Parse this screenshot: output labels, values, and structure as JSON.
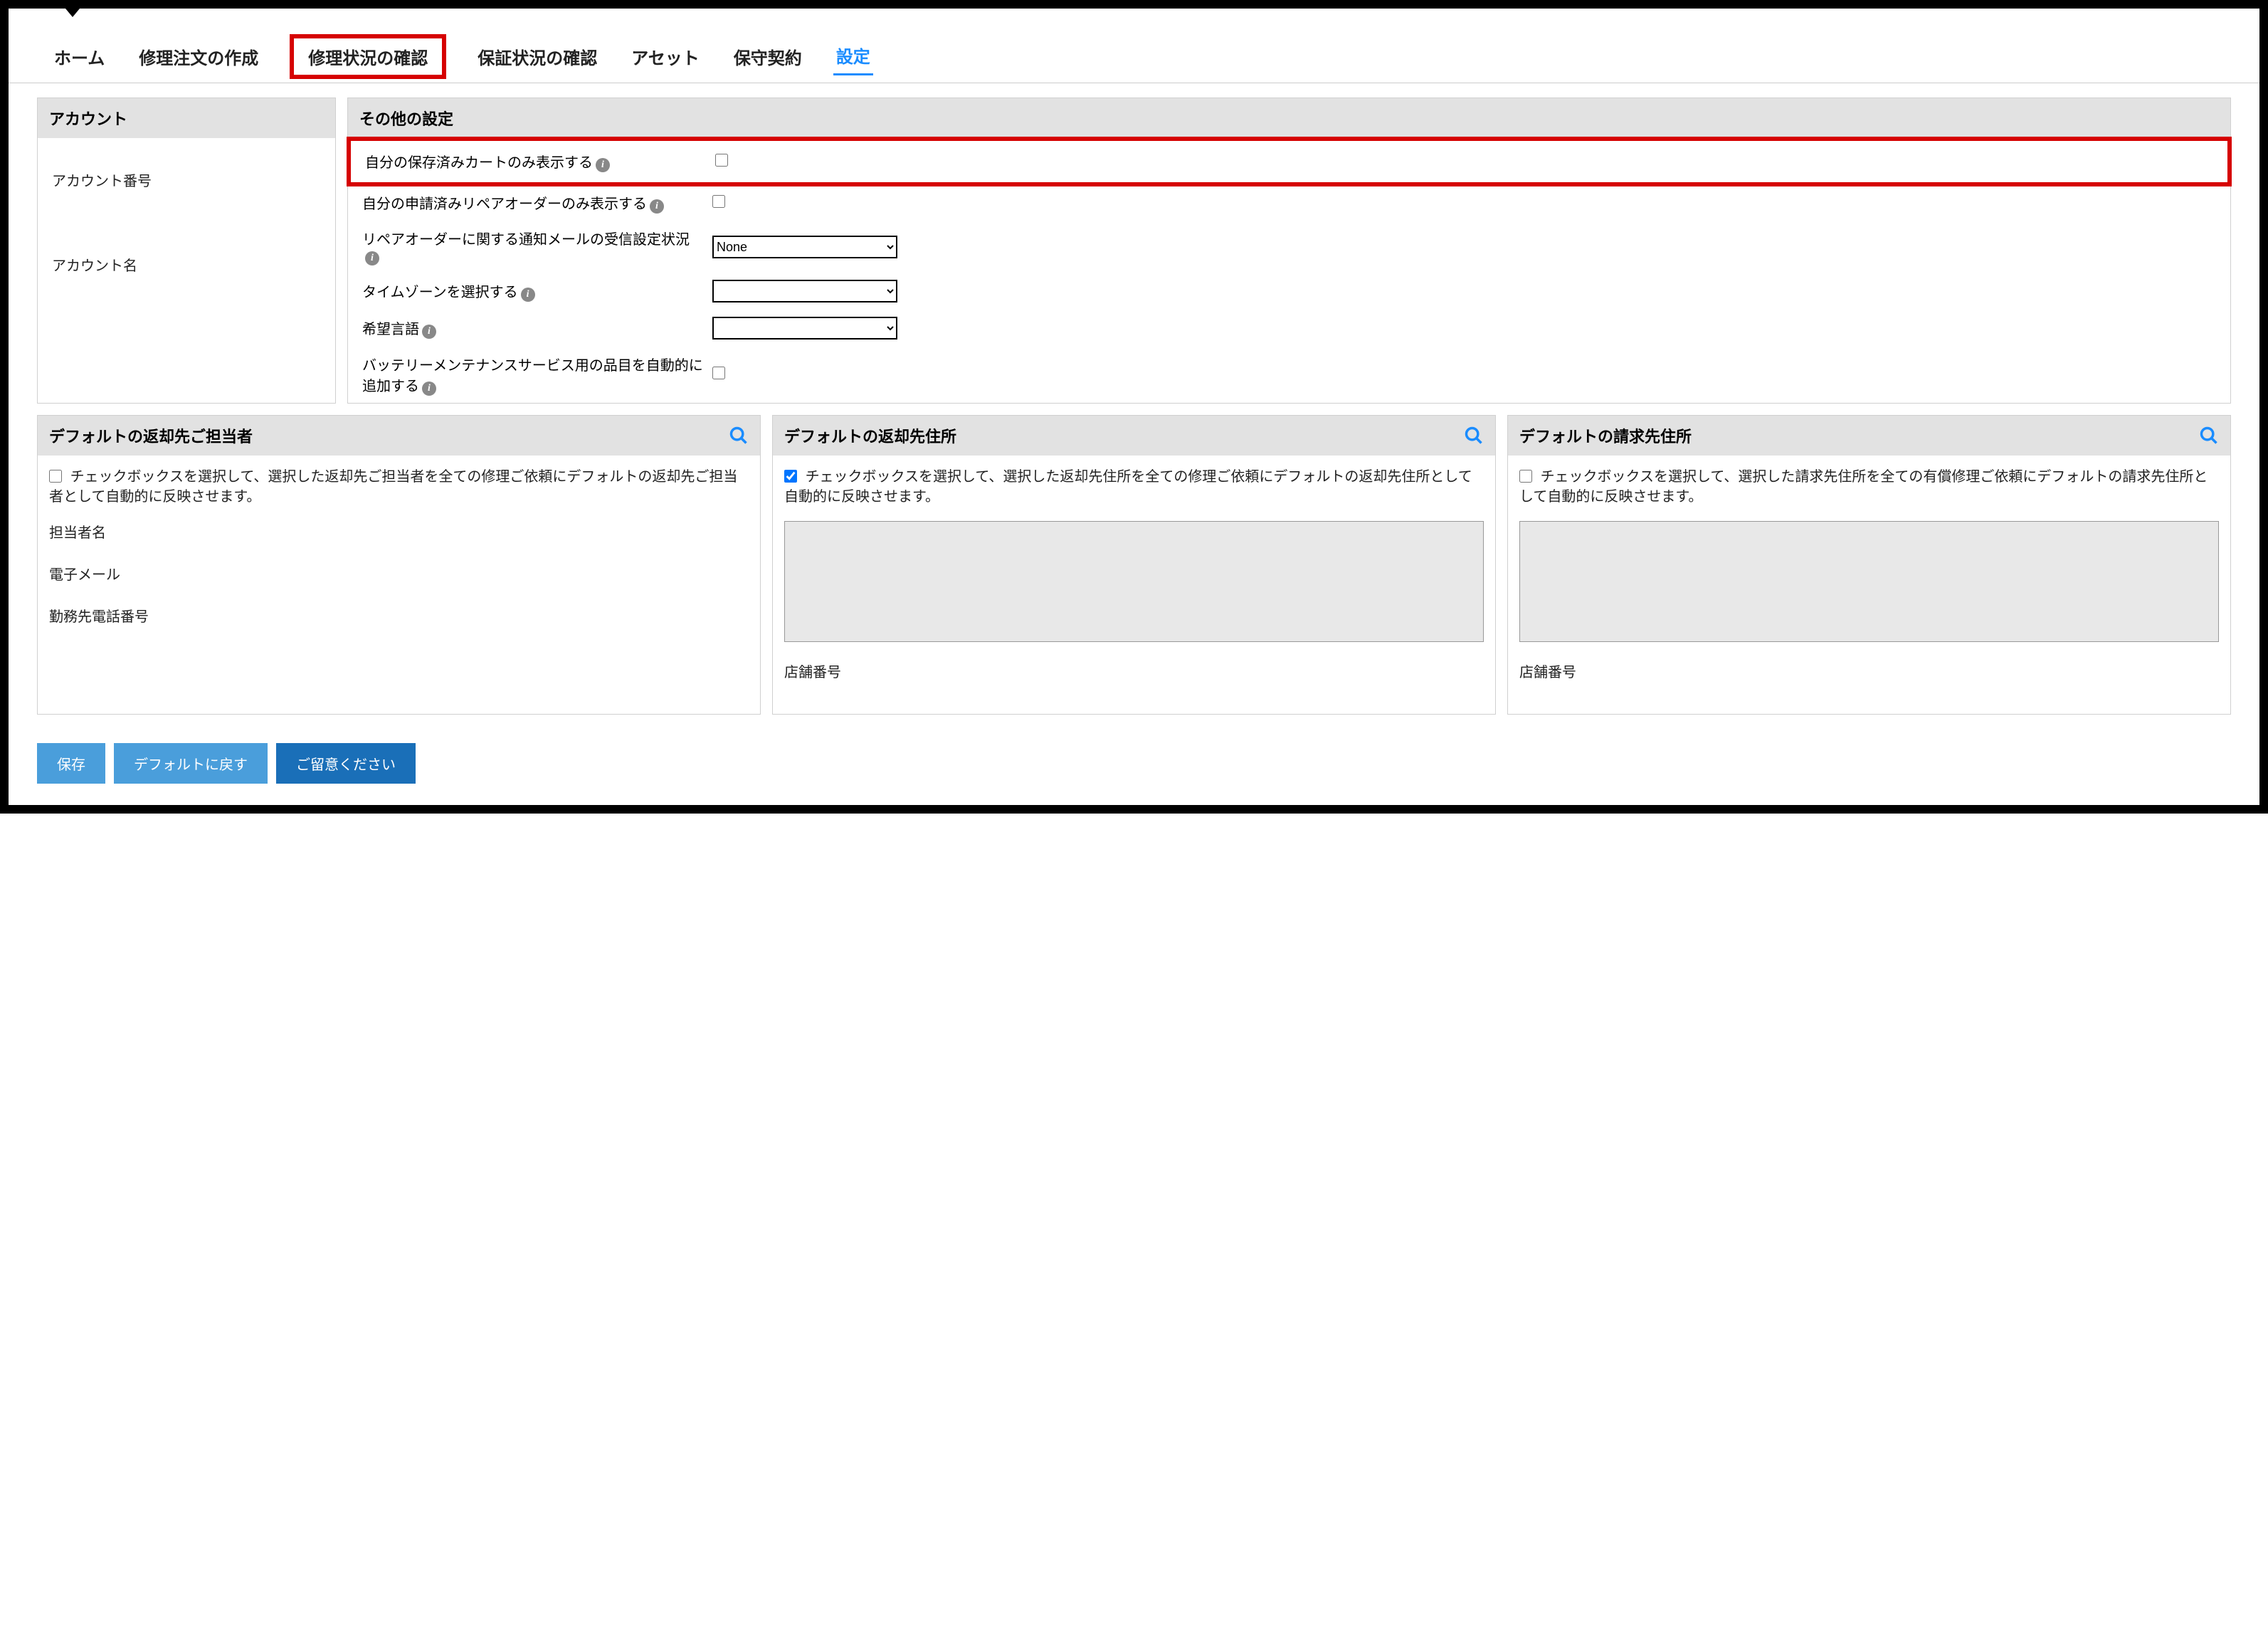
{
  "tabs": {
    "home": "ホーム",
    "create_repair": "修理注文の作成",
    "repair_status": "修理状況の確認",
    "warranty_status": "保証状況の確認",
    "asset": "アセット",
    "maintenance": "保守契約",
    "settings": "設定"
  },
  "account_panel": {
    "title": "アカウント",
    "account_number_label": "アカウント番号",
    "account_name_label": "アカウント名"
  },
  "other_panel": {
    "title": "その他の設定",
    "show_saved_carts": "自分の保存済みカートのみ表示する",
    "show_applied_repair_orders": "自分の申請済みリペアオーダーのみ表示する",
    "repair_order_notification": "リペアオーダーに関する通知メールの受信設定状況",
    "notification_value": "None",
    "select_timezone": "タイムゾーンを選択する",
    "timezone_value": "",
    "preferred_language": "希望言語",
    "language_value": "",
    "auto_add_battery": "バッテリーメンテナンスサービス用の品目を自動的に追加する"
  },
  "return_contact": {
    "title": "デフォルトの返却先ご担当者",
    "checkbox_desc": "チェックボックスを選択して、選択した返却先ご担当者を全ての修理ご依頼にデフォルトの返却先ご担当者として自動的に反映させます。",
    "checked": false,
    "contact_name_label": "担当者名",
    "email_label": "電子メール",
    "work_phone_label": "勤務先電話番号"
  },
  "return_address": {
    "title": "デフォルトの返却先住所",
    "checkbox_desc": "チェックボックスを選択して、選択した返却先住所を全ての修理ご依頼にデフォルトの返却先住所として自動的に反映させます。",
    "checked": true,
    "address_value": "",
    "store_number_label": "店舗番号"
  },
  "billing_address": {
    "title": "デフォルトの請求先住所",
    "checkbox_desc": "チェックボックスを選択して、選択した請求先住所を全ての有償修理ご依頼にデフォルトの請求先住所として自動的に反映させます。",
    "checked": false,
    "address_value": "",
    "store_number_label": "店舗番号"
  },
  "buttons": {
    "save": "保存",
    "reset_default": "デフォルトに戻す",
    "please_note": "ご留意ください"
  }
}
